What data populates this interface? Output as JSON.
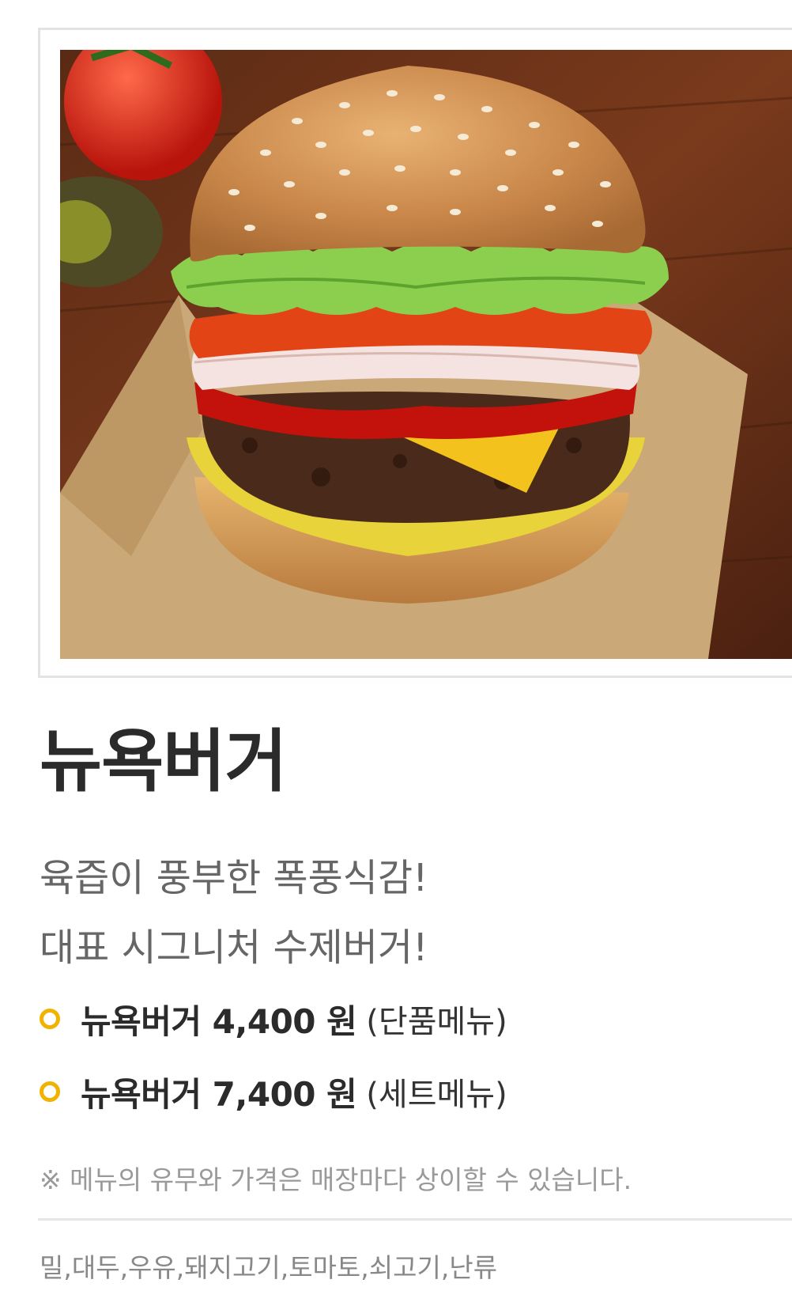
{
  "menu": {
    "title": "뉴욕버거",
    "description_lines": [
      "육즙이 풍부한 폭풍식감!",
      "대표 시그니처 수제버거!"
    ],
    "prices": [
      {
        "name": "뉴욕버거 4,400 원",
        "type": "(단품메뉴)"
      },
      {
        "name": "뉴욕버거 7,400 원",
        "type": "(세트메뉴)"
      }
    ],
    "notice": "※ 메뉴의 유무와 가격은 매장마다 상이할 수 있습니다.",
    "allergens": "밀,대두,우유,돼지고기,토마토,쇠고기,난류"
  },
  "colors": {
    "accent_dot": "#f0b400",
    "frame_border": "#e3e3e3"
  },
  "icons": {
    "bullet": "ring-bullet-icon"
  }
}
